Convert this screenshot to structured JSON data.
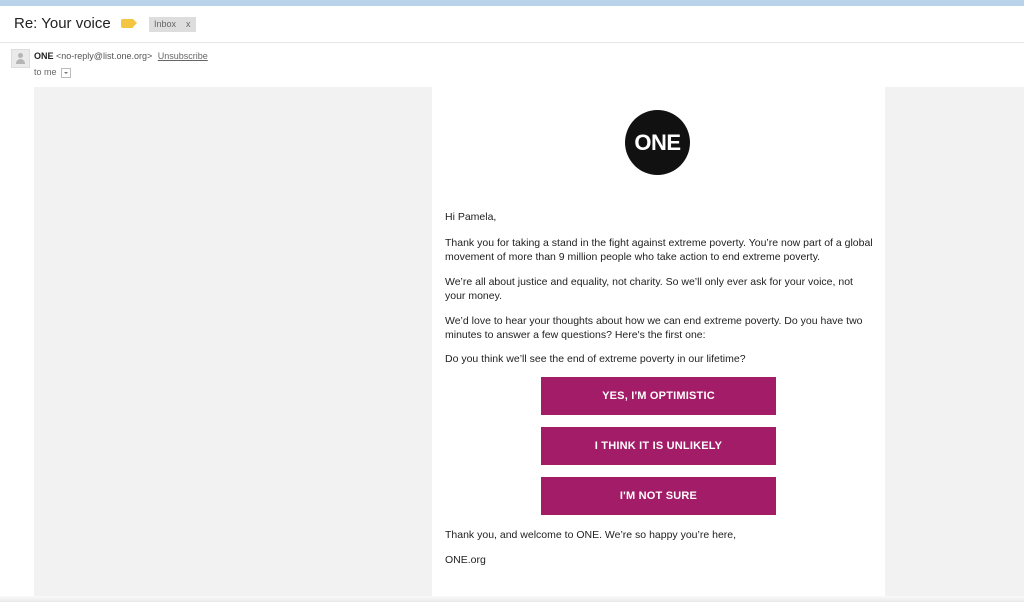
{
  "header": {
    "subject": "Re: Your voice",
    "label_color": "#f4c542",
    "inbox_chip": {
      "label": "Inbox",
      "close": "x"
    }
  },
  "message": {
    "sender_name": "ONE",
    "sender_email": "<no-reply@list.one.org>",
    "unsubscribe": "Unsubscribe",
    "to": "to me"
  },
  "email": {
    "logo_text": "ONE",
    "greeting": "Hi Pamela,",
    "para1": "Thank you for taking a stand in the fight against extreme poverty. You’re now part of a global movement of more than 9 million people who take action to end extreme poverty.",
    "para2": "We’re all about justice and equality, not charity. So we’ll only ever ask for your voice, not your money.",
    "para3": "We’d love to hear your thoughts about how we can end extreme poverty. Do you have two minutes to answer a few questions? Here's the first one:",
    "question": "Do you think we’ll see the end of extreme poverty in our lifetime?",
    "buttons": [
      "YES, I'M OPTIMISTIC",
      "I THINK IT IS UNLIKELY",
      "I'M NOT SURE"
    ],
    "closing": "Thank you, and welcome to ONE. We’re so happy you’re here,",
    "signature": "ONE.org",
    "button_color": "#a31c67"
  }
}
